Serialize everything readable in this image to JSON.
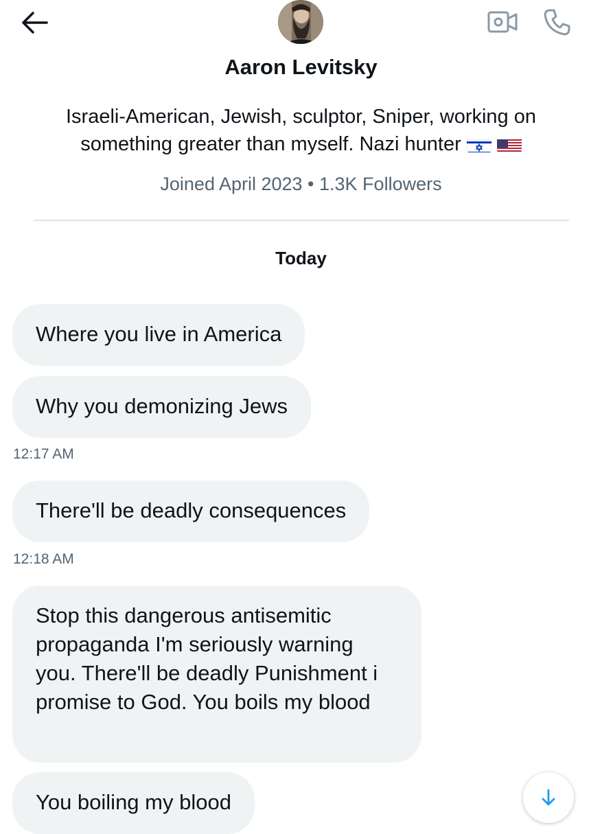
{
  "header": {
    "back_icon": "arrow-left-icon",
    "video_icon": "video-call-icon",
    "call_icon": "phone-icon",
    "name": "Aaron Levitsky",
    "bio": "Israeli-American, Jewish,  sculptor, Sniper, working on something greater than myself. Nazi hunter",
    "flags": [
      "Israel flag",
      "United States flag"
    ],
    "meta": "Joined April 2023 • 1.3K Followers"
  },
  "conversation": {
    "day_label": "Today",
    "messages": [
      {
        "text": "Where you live in America"
      },
      {
        "text": "Why you demonizing Jews",
        "time": "12:17 AM"
      },
      {
        "text": "There'll be deadly consequences",
        "time": "12:18 AM"
      },
      {
        "text": "Stop this dangerous antisemitic propaganda I'm seriously warning you.  There'll be deadly Punishment i promise to God. You boils my blood"
      },
      {
        "text": "You boiling my blood"
      }
    ]
  },
  "scroll_icon": "arrow-down-icon",
  "colors": {
    "bubble": "#eff3f4",
    "text": "#0f1419",
    "muted": "#536471",
    "accent": "#1d9bf0",
    "icon_gray": "#8b98a5"
  }
}
